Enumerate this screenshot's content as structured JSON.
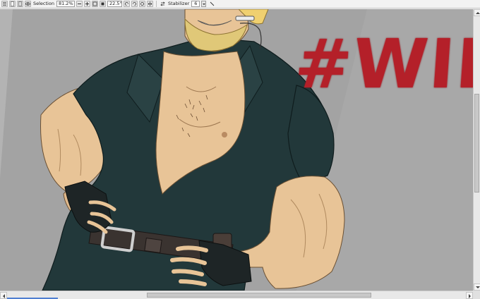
{
  "toolbar": {
    "selection_label": "Selection",
    "zoom_value": "81.2%",
    "angle_value": "22.5°",
    "stabilizer_label": "Stabilizer",
    "stabilizer_value": "6"
  },
  "canvas": {
    "background_color": "#9f9f9f",
    "artwork_overlay_text": "#WIP",
    "overlay_text_color": "#b42029"
  },
  "scrollbars": {
    "horizontal_position_fraction": 0.31,
    "horizontal_visible_fraction": 0.47,
    "vertical_position_fraction": 0.3,
    "vertical_visible_fraction": 0.35
  }
}
